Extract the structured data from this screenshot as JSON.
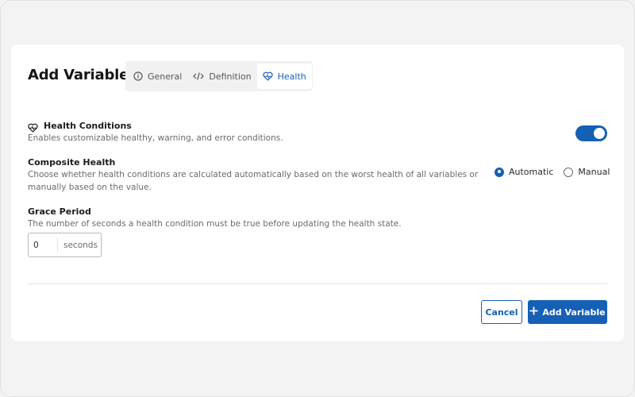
{
  "dialog": {
    "title": "Add Variable"
  },
  "tabs": [
    {
      "label": "General",
      "icon": "info-circle-icon",
      "active": false
    },
    {
      "label": "Definition",
      "icon": "code-icon",
      "active": false
    },
    {
      "label": "Health",
      "icon": "heart-pulse-icon",
      "active": true
    }
  ],
  "health_conditions": {
    "title": "Health Conditions",
    "description": "Enables customizable healthy, warning, and error conditions.",
    "enabled": true
  },
  "composite_health": {
    "title": "Composite Health",
    "description_line1": "Choose whether health conditions are calculated automatically based on the worst health of all variables or",
    "description_line2": "manually based on the value.",
    "options": [
      {
        "label": "Automatic",
        "selected": true
      },
      {
        "label": "Manual",
        "selected": false
      }
    ]
  },
  "grace_period": {
    "title": "Grace Period",
    "description": "The number of seconds a health condition must be true before updating the health state.",
    "value": "0",
    "unit": "seconds"
  },
  "actions": {
    "cancel_label": "Cancel",
    "add_label": "Add Variable",
    "add_icon": "plus-icon"
  },
  "colors": {
    "accent": "#1560b5",
    "background": "#f3f3f4",
    "card": "#ffffff"
  }
}
